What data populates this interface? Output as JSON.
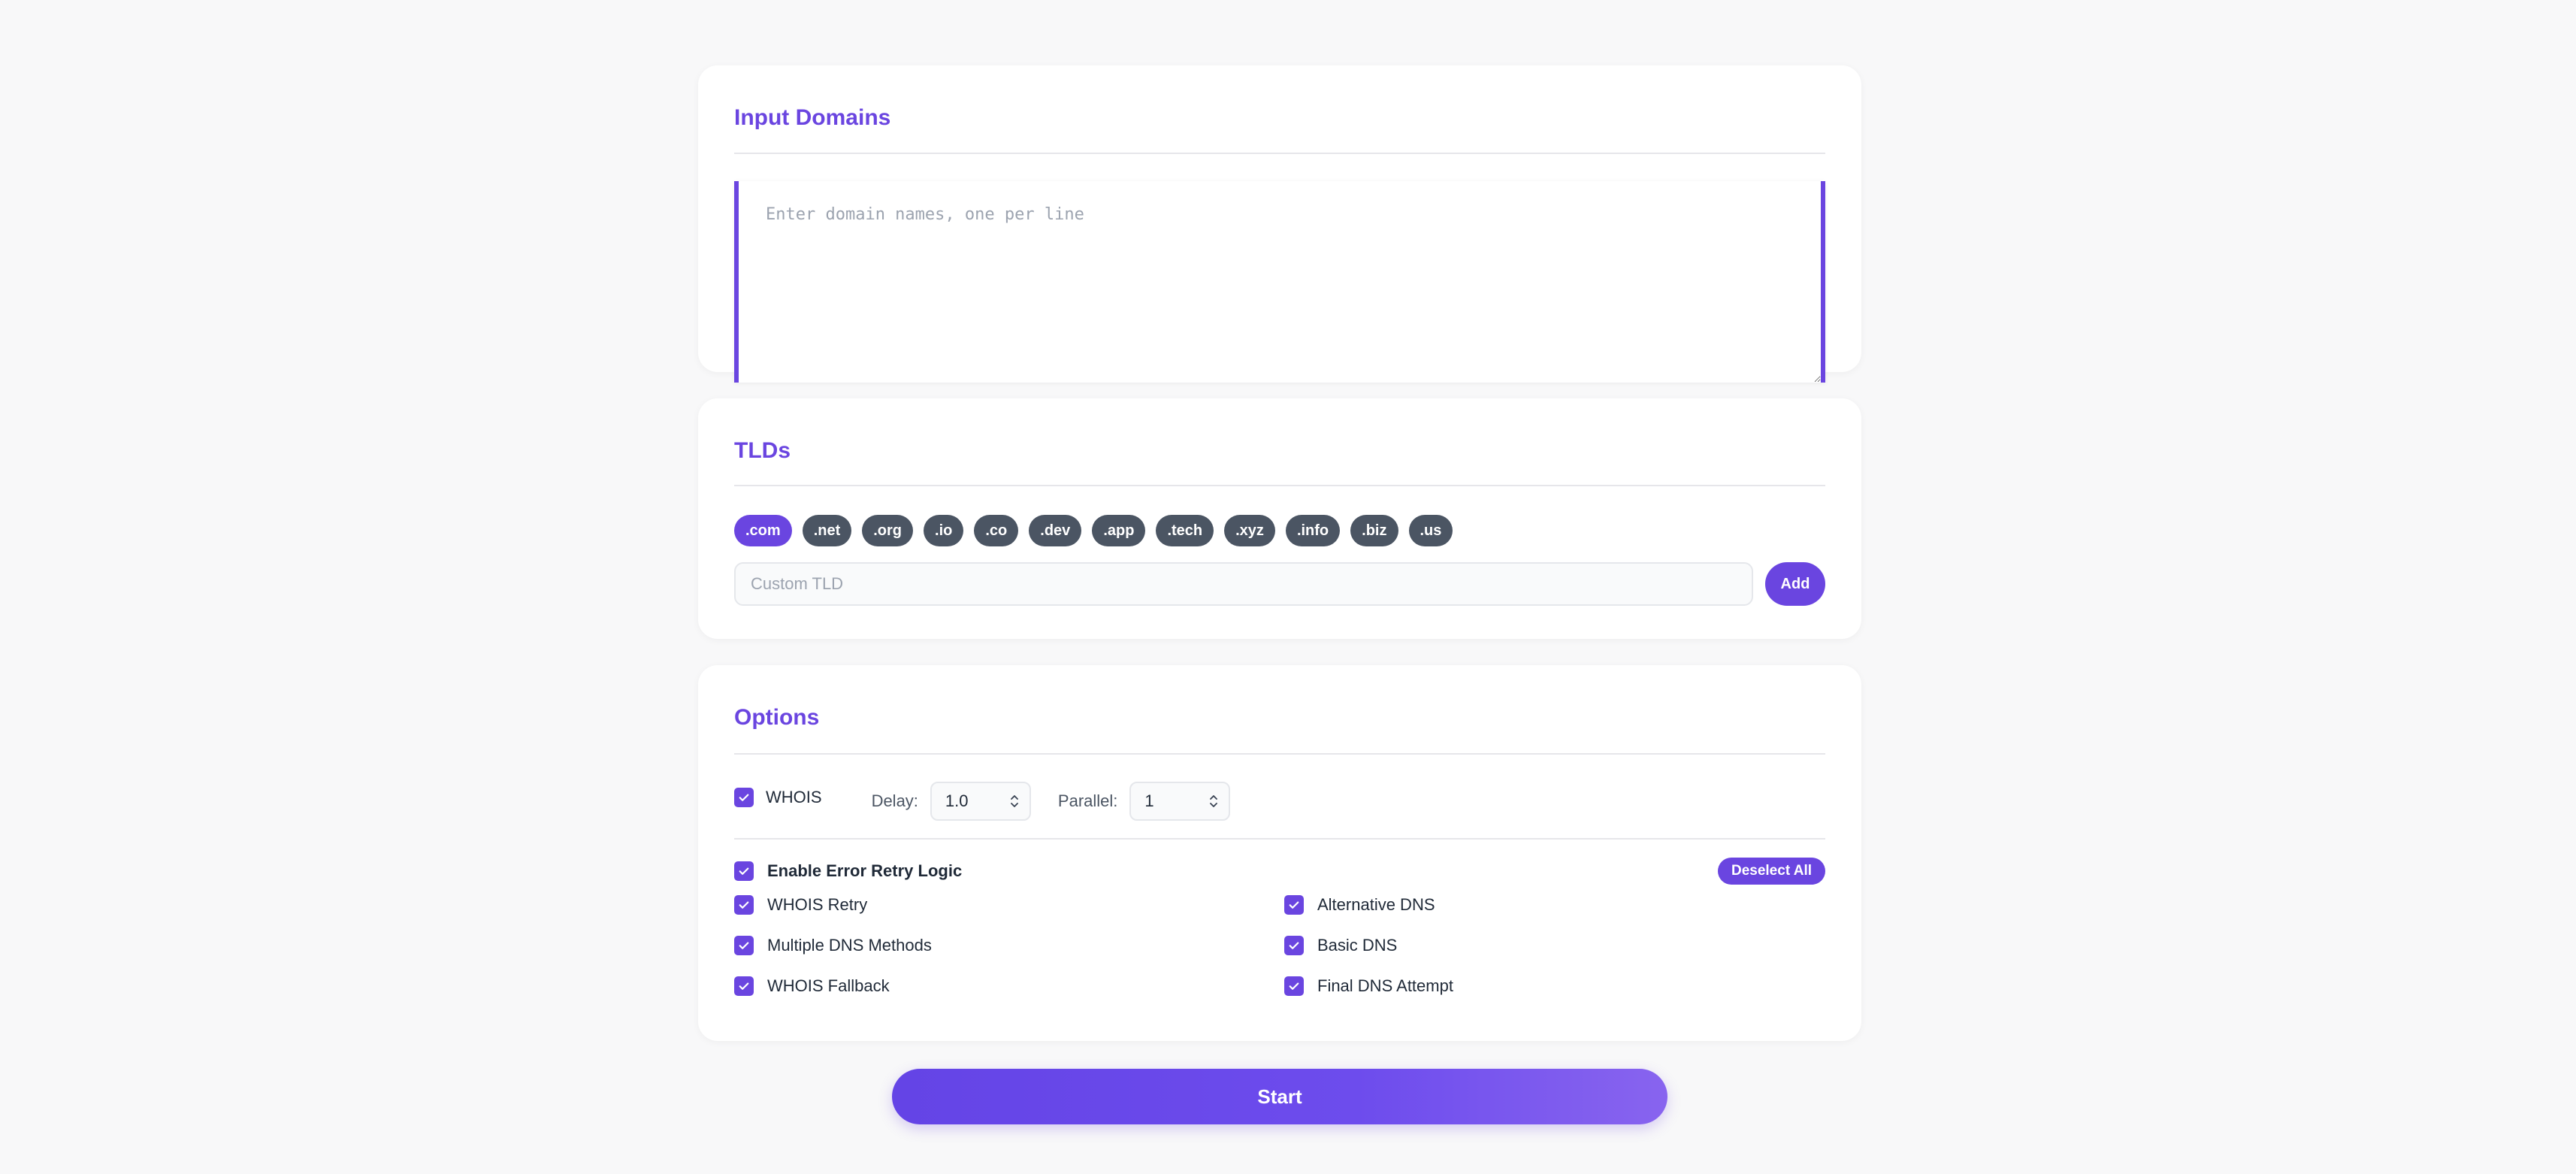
{
  "input_domains": {
    "title": "Input Domains",
    "textarea_value": "",
    "textarea_placeholder": "Enter domain names, one per line"
  },
  "tlds": {
    "title": "TLDs",
    "chips": [
      {
        "label": ".com",
        "active": true
      },
      {
        "label": ".net",
        "active": false
      },
      {
        "label": ".org",
        "active": false
      },
      {
        "label": ".io",
        "active": false
      },
      {
        "label": ".co",
        "active": false
      },
      {
        "label": ".dev",
        "active": false
      },
      {
        "label": ".app",
        "active": false
      },
      {
        "label": ".tech",
        "active": false
      },
      {
        "label": ".xyz",
        "active": false
      },
      {
        "label": ".info",
        "active": false
      },
      {
        "label": ".biz",
        "active": false
      },
      {
        "label": ".us",
        "active": false
      }
    ],
    "custom_placeholder": "Custom TLD",
    "custom_value": "",
    "add_label": "Add"
  },
  "options": {
    "title": "Options",
    "whois_label": "WHOIS",
    "whois_checked": true,
    "delay_label": "Delay:",
    "delay_value": "1.0",
    "parallel_label": "Parallel:",
    "parallel_value": "1",
    "retry_title": "Enable Error Retry Logic",
    "retry_checked": true,
    "deselect_label": "Deselect All",
    "retry_items": [
      {
        "label": "WHOIS Retry",
        "checked": true
      },
      {
        "label": "Alternative DNS",
        "checked": true
      },
      {
        "label": "Multiple DNS Methods",
        "checked": true
      },
      {
        "label": "Basic DNS",
        "checked": true
      },
      {
        "label": "WHOIS Fallback",
        "checked": true
      },
      {
        "label": "Final DNS Attempt",
        "checked": true
      }
    ]
  },
  "start_label": "Start",
  "colors": {
    "accent": "#6a45e0",
    "chip_inactive": "#4b5563",
    "background": "#f8f8f9"
  }
}
